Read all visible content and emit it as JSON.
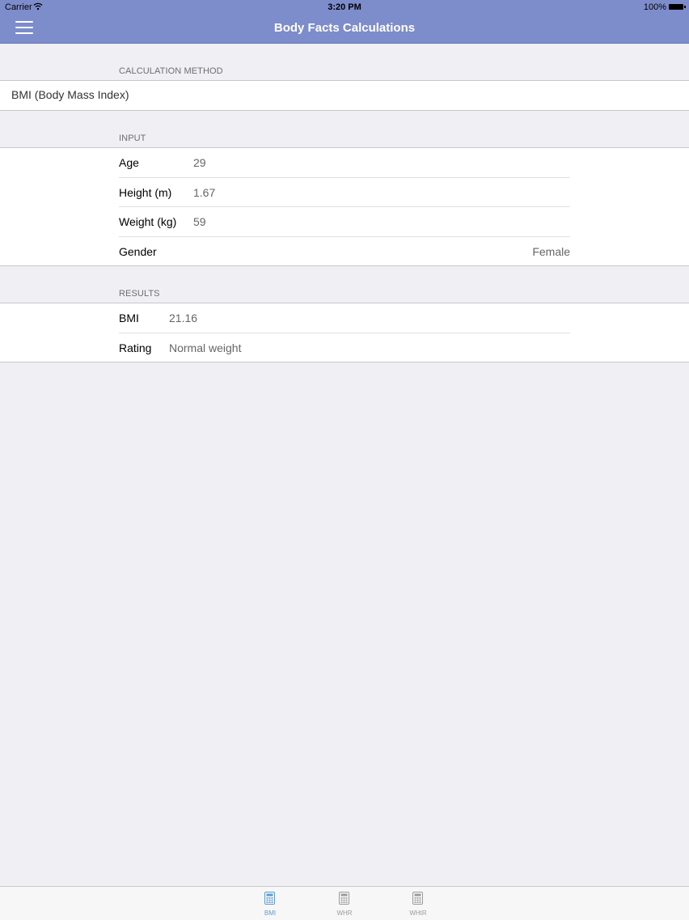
{
  "status_bar": {
    "carrier": "Carrier",
    "time": "3:20 PM",
    "battery": "100%"
  },
  "nav": {
    "title": "Body Facts Calculations"
  },
  "method_section": {
    "header": "CALCULATION METHOD",
    "value": "BMI (Body Mass Index)"
  },
  "input_section": {
    "header": "INPUT",
    "rows": [
      {
        "label": "Age",
        "value": "29"
      },
      {
        "label": "Height (m)",
        "value": "1.67"
      },
      {
        "label": "Weight (kg)",
        "value": "59"
      },
      {
        "label": "Gender",
        "value": "Female"
      }
    ]
  },
  "results_section": {
    "header": "RESULTS",
    "rows": [
      {
        "label": "BMI",
        "value": "21.16"
      },
      {
        "label": "Rating",
        "value": "Normal weight"
      }
    ]
  },
  "tabs": [
    {
      "label": "BMI",
      "icon": "calculator-icon",
      "active": true
    },
    {
      "label": "WHR",
      "icon": "calculator-icon",
      "active": false
    },
    {
      "label": "WHtR",
      "icon": "calculator-icon",
      "active": false
    }
  ],
  "colors": {
    "nav_bar": "#7d8ccb",
    "tab_active": "#5b9bd5",
    "tab_inactive": "#9b9b9b",
    "background": "#efeff4"
  }
}
